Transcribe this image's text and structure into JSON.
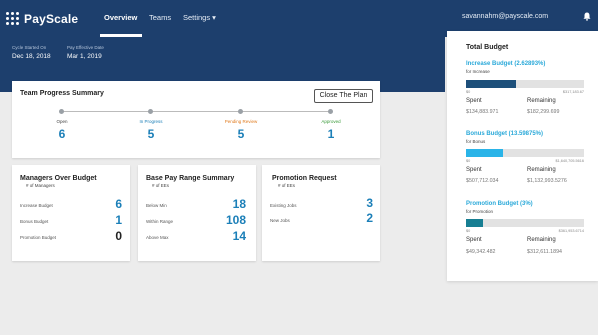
{
  "nav": {
    "brand": "PayScale",
    "items": [
      "Overview",
      "Teams",
      "Settings ▾"
    ],
    "user_email": "savannahm@payscale.com"
  },
  "header": {
    "cycle_started_label": "Cycle Started On",
    "cycle_started_value": "Dec 18, 2018",
    "pay_effective_label": "Pay Effective Date",
    "pay_effective_value": "Mar 1, 2019"
  },
  "progress": {
    "title": "Team Progress Summary",
    "close_button": "Close The Plan",
    "steps": [
      {
        "label": "Open",
        "count": "6",
        "color": "#444444"
      },
      {
        "label": "In Progress",
        "count": "5",
        "color": "#1b7fb8"
      },
      {
        "label": "Pending Review",
        "count": "5",
        "color": "#e07b1f"
      },
      {
        "label": "Approved",
        "count": "1",
        "color": "#3a9a3a"
      }
    ]
  },
  "managers_over_budget": {
    "title": "Managers Over Budget",
    "subtitle": "# of Managers",
    "rows": [
      {
        "label": "Increase Budget",
        "value": "6",
        "color": "#1b7fb8"
      },
      {
        "label": "Bonus Budget",
        "value": "1",
        "color": "#1b7fb8"
      },
      {
        "label": "Promotion Budget",
        "value": "0",
        "color": "#222222"
      }
    ]
  },
  "base_pay_range": {
    "title": "Base Pay Range Summary",
    "subtitle": "# of EEs",
    "rows": [
      {
        "label": "Below Min",
        "value": "18"
      },
      {
        "label": "Within Range",
        "value": "108"
      },
      {
        "label": "Above Max",
        "value": "14"
      }
    ]
  },
  "promotion_request": {
    "title": "Promotion Request",
    "subtitle": "# of EEs",
    "rows": [
      {
        "label": "Existing Jobs",
        "value": "3"
      },
      {
        "label": "New Jobs",
        "value": "2"
      }
    ]
  },
  "total_budget": {
    "title": "Total Budget",
    "spent_label": "Spent",
    "remaining_label": "Remaining",
    "sections": [
      {
        "title": "Increase Budget (2.62893%)",
        "subtitle": "for Increase",
        "min": "$0",
        "max": "$317,183.67",
        "spent": "$134,883.971",
        "remaining": "$182,299.699",
        "fill_fraction": 0.42,
        "fill_color": "#1d4f7a"
      },
      {
        "title": "Bonus Budget (13.59875%)",
        "subtitle": "for Bonus",
        "min": "$0",
        "max": "$1,640,705.5616",
        "spent": "$507,712.034",
        "remaining": "$1,132,993.5276",
        "fill_fraction": 0.31,
        "fill_color": "#2ab4e8"
      },
      {
        "title": "Promotion Budget (3%)",
        "subtitle": "for Promotion",
        "min": "$0",
        "max": "$361,953.6714",
        "spent": "$49,342.482",
        "remaining": "$312,611.1894",
        "fill_fraction": 0.14,
        "fill_color": "#177e92"
      }
    ]
  }
}
